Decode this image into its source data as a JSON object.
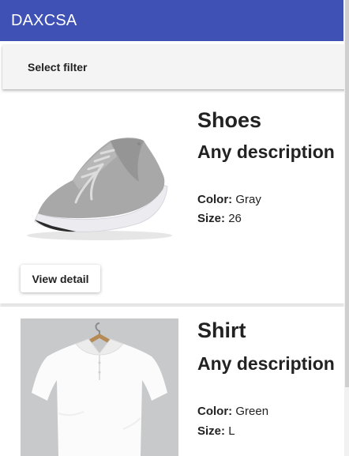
{
  "app": {
    "title": "DAXCSA"
  },
  "filter": {
    "label": "Select filter"
  },
  "products": [
    {
      "title": "Shoes",
      "description": "Any description",
      "color_label": "Color:",
      "color_value": "Gray",
      "size_label": "Size:",
      "size_value": "26",
      "button_label": "View detail",
      "image_icon": "sneaker-image"
    },
    {
      "title": "Shirt",
      "description": "Any description",
      "color_label": "Color:",
      "color_value": "Green",
      "size_label": "Size:",
      "size_value": "L",
      "image_icon": "polo-shirt-image"
    }
  ],
  "colors": {
    "app_bar": "#3f51b5",
    "filter_bar": "#f4f4f4",
    "text": "#222222"
  }
}
